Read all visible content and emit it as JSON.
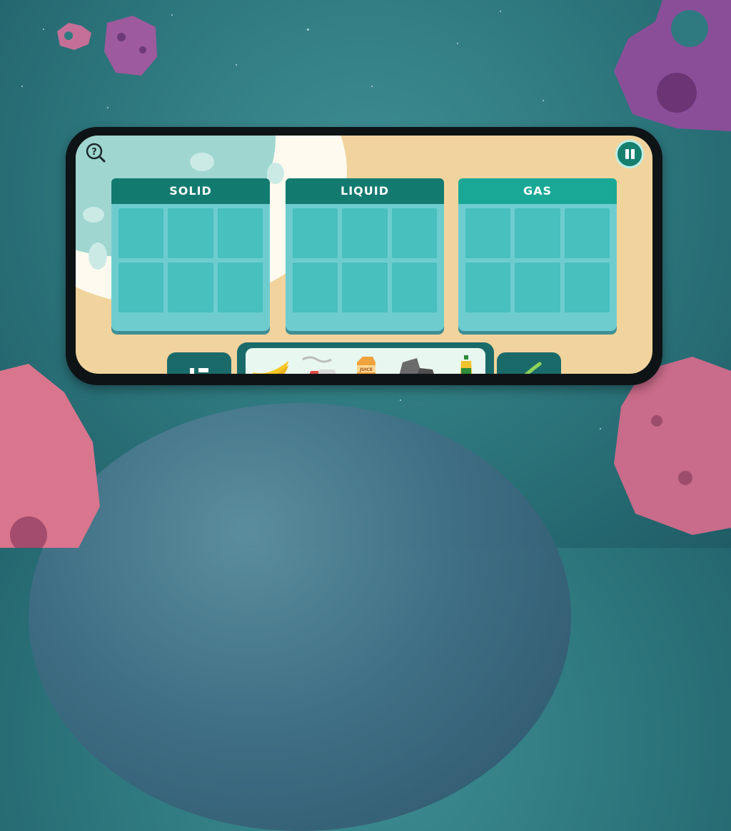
{
  "game": {
    "categories": [
      {
        "label": "SOLID"
      },
      {
        "label": "LIQUID"
      },
      {
        "label": "GAS"
      }
    ],
    "slots_per_category": 6,
    "tray_items": [
      {
        "name": "banana"
      },
      {
        "name": "steaming-cup"
      },
      {
        "name": "juice-carton",
        "label": "JUICE"
      },
      {
        "name": "rocks"
      },
      {
        "name": "oil-bottle"
      }
    ]
  },
  "colors": {
    "background": "#2f7a80",
    "panel": "#6ecccf",
    "header_solid": "#137a6f",
    "header_liquid": "#137a6f",
    "header_gas": "#1aa896",
    "sand": "#f1d49d"
  }
}
